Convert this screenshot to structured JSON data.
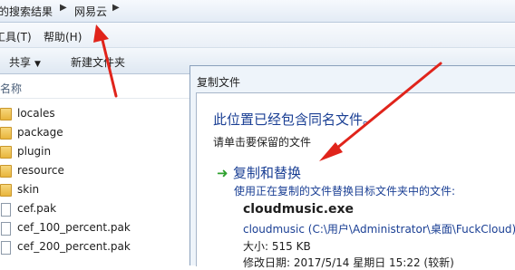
{
  "address_bar": {
    "crumb_1": "的搜索结果",
    "crumb_2": "网易云"
  },
  "menu": {
    "tools": "工具(T)",
    "help": "帮助(H)"
  },
  "toolbar": {
    "share": "共享",
    "new_folder": "新建文件夹"
  },
  "file_list": {
    "column_name": "名称",
    "items": [
      {
        "name": "locales",
        "type": "folder"
      },
      {
        "name": "package",
        "type": "folder"
      },
      {
        "name": "plugin",
        "type": "folder"
      },
      {
        "name": "resource",
        "type": "folder"
      },
      {
        "name": "skin",
        "type": "folder"
      },
      {
        "name": "cef.pak",
        "type": "file"
      },
      {
        "name": "cef_100_percent.pak",
        "type": "file"
      },
      {
        "name": "cef_200_percent.pak",
        "type": "file"
      }
    ]
  },
  "dialog": {
    "title": "复制文件",
    "heading": "此位置已经包含同名文件。",
    "subheading": "请单击要保留的文件",
    "option": {
      "title": "复制和替换",
      "description": "使用正在复制的文件替换目标文件夹中的文件:"
    },
    "file": {
      "name": "cloudmusic.exe",
      "path": "cloudmusic (C:\\用户\\Administrator\\桌面\\FuckCloud)",
      "size": "大小: 515 KB",
      "modified": "修改日期: 2017/5/14 星期日 15:22 (较新)"
    }
  },
  "colors": {
    "link_blue": "#1a3f94",
    "arrow_red": "#e0241b",
    "check_green": "#2ea12e"
  }
}
